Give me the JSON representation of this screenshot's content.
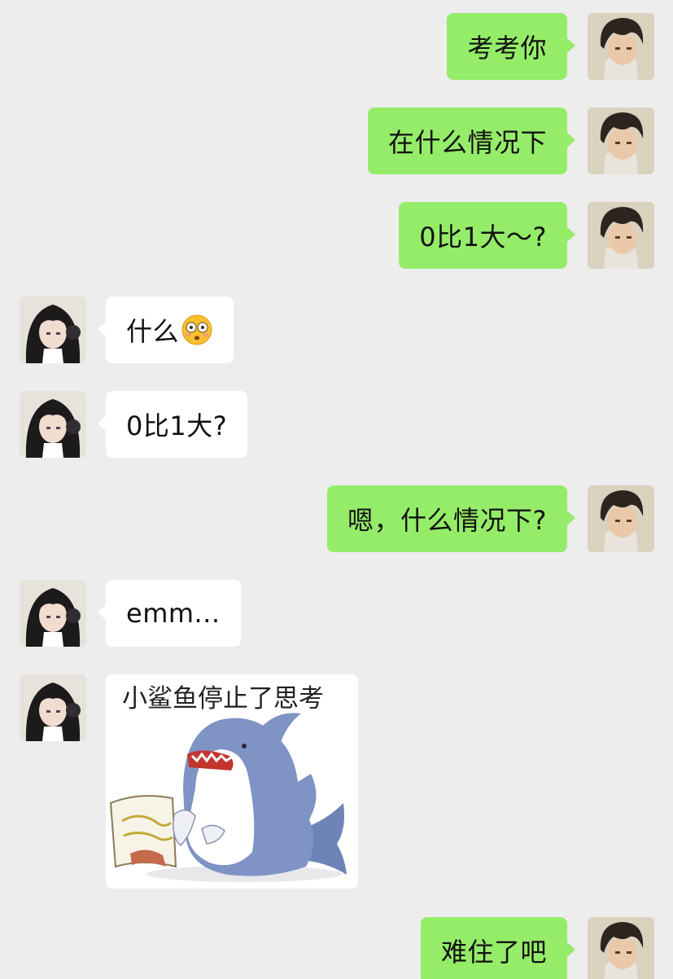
{
  "messages": [
    {
      "side": "me",
      "text": "考考你"
    },
    {
      "side": "me",
      "text": "在什么情况下"
    },
    {
      "side": "me",
      "text": "0比1大～?"
    },
    {
      "side": "them",
      "text": "什么",
      "emoji": "flushed-face-icon"
    },
    {
      "side": "them",
      "text": "0比1大?"
    },
    {
      "side": "me",
      "text": "嗯，什么情况下?"
    },
    {
      "side": "them",
      "text": "emm..."
    },
    {
      "side": "them",
      "sticker_caption": "小鲨鱼停止了思考"
    },
    {
      "side": "me",
      "text": "难住了吧"
    }
  ],
  "colors": {
    "background": "#ededed",
    "my_bubble": "#95ec69",
    "their_bubble": "#ffffff"
  }
}
